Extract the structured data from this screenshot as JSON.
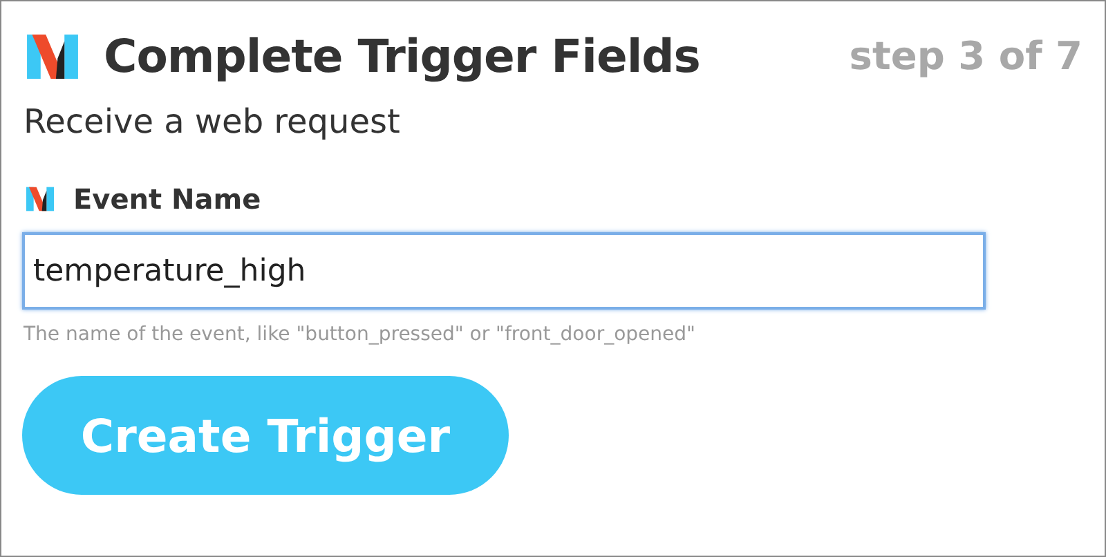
{
  "header": {
    "title": "Complete Trigger Fields",
    "step": "step 3 of 7"
  },
  "subtitle": "Receive a web request",
  "field": {
    "label": "Event Name",
    "value": "temperature_high",
    "focused": true,
    "hint": "The name of the event, like \"button_pressed\" or \"front_door_opened\""
  },
  "button": {
    "label": "Create Trigger"
  }
}
